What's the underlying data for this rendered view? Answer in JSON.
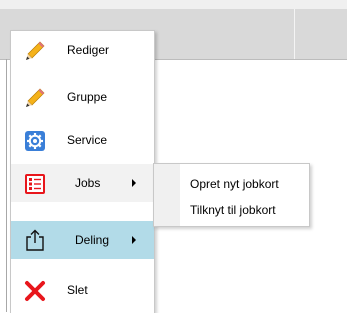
{
  "context_menu": {
    "items": [
      {
        "label": "Rediger",
        "icon": "pencil-icon"
      },
      {
        "label": "Gruppe",
        "icon": "pencil-icon"
      },
      {
        "label": "Service",
        "icon": "gear-icon"
      },
      {
        "label": "Jobs",
        "icon": "checklist-icon",
        "has_submenu": true
      },
      {
        "label": "Deling",
        "icon": "share-icon",
        "has_submenu": true
      },
      {
        "label": "Slet",
        "icon": "delete-x-icon"
      }
    ]
  },
  "jobs_submenu": {
    "items": [
      {
        "label": "Opret nyt jobkort"
      },
      {
        "label": "Tilknyt til jobkort"
      }
    ]
  },
  "colors": {
    "header_bg": "#d9d9d9",
    "hover_bg": "#b2dbe8",
    "open_item_bg": "#f2f2f2",
    "delete_red": "#e8161c",
    "gear_blue": "#3a7fd8"
  }
}
